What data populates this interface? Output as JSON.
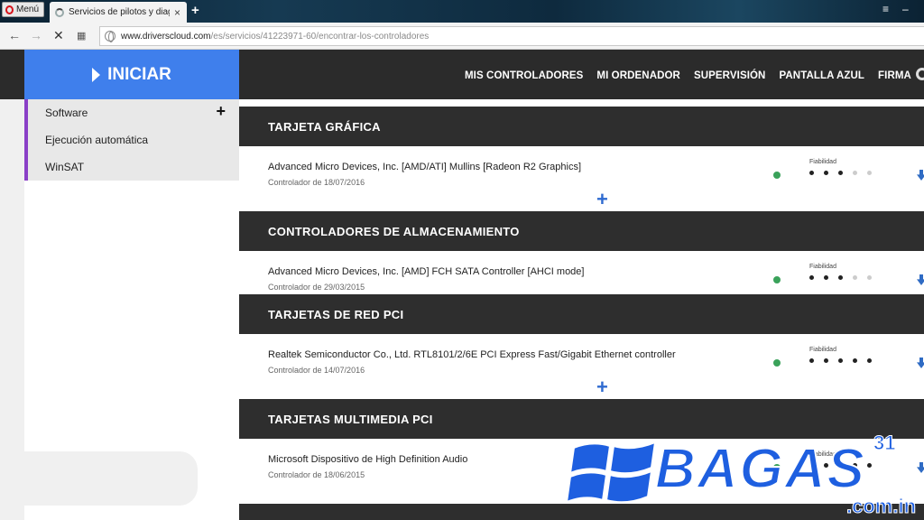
{
  "browser": {
    "menu_label": "Menú",
    "tab_title": "Servicios de pilotos y diag",
    "tab_close": "×",
    "new_tab": "+",
    "url_host": "www.driverscloud.com",
    "url_path": "/es/servicios/41223971-60/encontrar-los-controladores"
  },
  "site": {
    "start_label": "INICIAR",
    "nav": [
      "MIS CONTROLADORES",
      "MI ORDENADOR",
      "SUPERVISIÓN",
      "PANTALLA AZUL",
      "FIRMA"
    ],
    "sidebar": [
      {
        "label": "Software",
        "has_plus": true
      },
      {
        "label": "Ejecución automática"
      },
      {
        "label": "WinSAT"
      }
    ],
    "sidebar_plus": "+"
  },
  "sections": [
    {
      "title": "TARJETA GRÁFICA",
      "driver": {
        "name": "Advanced Micro Devices, Inc. [AMD/ATI] Mullins [Radeon R2 Graphics]",
        "date": "Controlador de 18/07/2016",
        "reliability_label": "Fiabilidad",
        "reliability": 3
      }
    },
    {
      "title": "CONTROLADORES DE ALMACENAMIENTO",
      "driver": {
        "name": "Advanced Micro Devices, Inc. [AMD] FCH SATA Controller [AHCI mode]",
        "date": "Controlador de 29/03/2015",
        "reliability_label": "Fiabilidad",
        "reliability": 3
      }
    },
    {
      "title": "TARJETAS DE RED PCI",
      "driver": {
        "name": "Realtek Semiconductor Co., Ltd. RTL8101/2/6E PCI Express Fast/Gigabit Ethernet controller",
        "date": "Controlador de 14/07/2016",
        "reliability_label": "Fiabilidad",
        "reliability": 5
      }
    },
    {
      "title": "TARJETAS MULTIMEDIA PCI",
      "driver": {
        "name": "Microsoft Dispositivo de High Definition Audio",
        "date": "Controlador de 18/06/2015",
        "reliability_label": "Fiabilidad",
        "reliability": 5
      }
    }
  ],
  "add_more": "+",
  "watermark": {
    "brand": "BAGAS",
    "num": "31",
    "domain": ".com.in"
  },
  "colors": {
    "start_bg": "#3f7fec",
    "header_bg": "#2b2b2b",
    "status_ok": "#3aa25a",
    "accent": "#8a3fc7"
  }
}
